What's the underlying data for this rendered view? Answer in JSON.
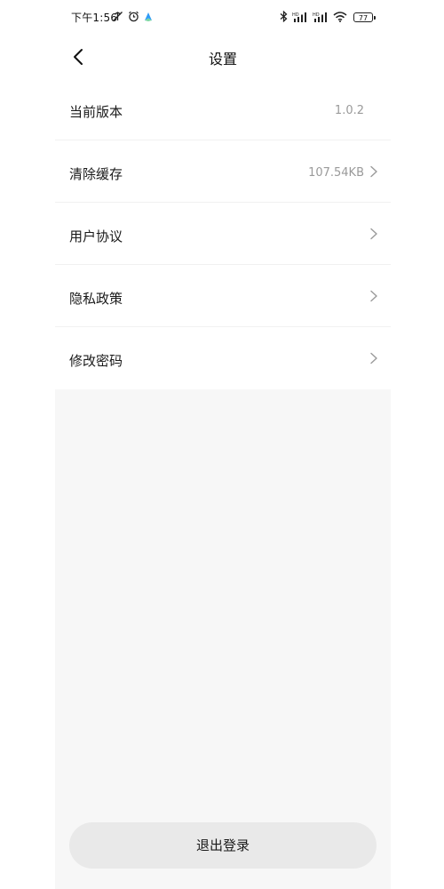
{
  "status_bar": {
    "time": "下午1:56",
    "battery": "77",
    "icons": [
      "mute-icon",
      "alarm-icon",
      "app-notification-icon",
      "bluetooth-icon",
      "signal-hd-1-icon",
      "signal-hd-2-icon",
      "wifi-icon",
      "battery-icon"
    ]
  },
  "header": {
    "title": "设置"
  },
  "settings": {
    "items": [
      {
        "label": "当前版本",
        "value": "1.0.2"
      },
      {
        "label": "清除缓存",
        "value": "107.54KB"
      },
      {
        "label": "用户协议"
      },
      {
        "label": "隐私政策"
      },
      {
        "label": "修改密码"
      }
    ]
  },
  "logout": {
    "label": "退出登录"
  }
}
